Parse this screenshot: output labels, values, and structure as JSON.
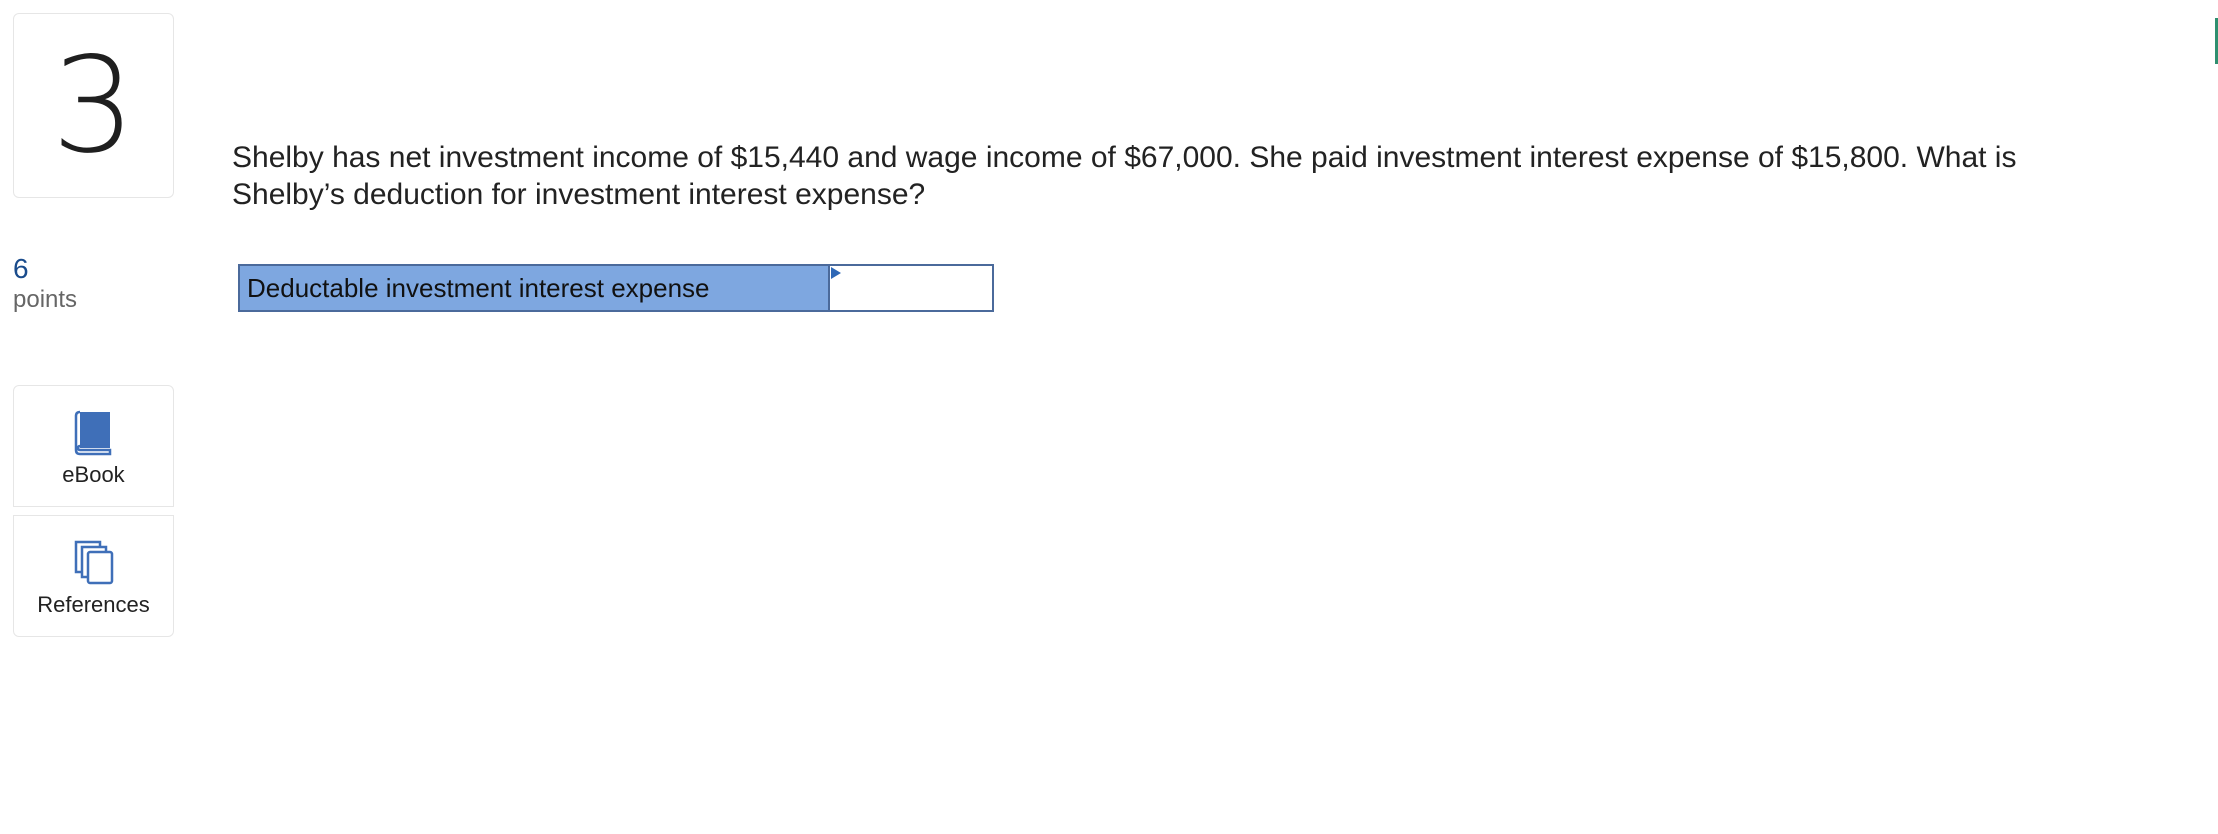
{
  "question": {
    "number": "3",
    "points_value": "6",
    "points_label": "points",
    "text": "Shelby has net investment income of $15,440 and wage income of $67,000. She paid investment interest expense of $15,800. What is Shelby’s deduction for investment interest expense?"
  },
  "sidebar": {
    "ebook_label": "eBook",
    "references_label": "References",
    "ebook_icon": "book-icon",
    "references_icon": "documents-icon",
    "icon_color": "#3f6fb8"
  },
  "answer": {
    "row_label": "Deductable investment interest expense",
    "input_value": "",
    "label_bg_color": "#7ea7e0",
    "border_color": "#4b6a9b"
  }
}
